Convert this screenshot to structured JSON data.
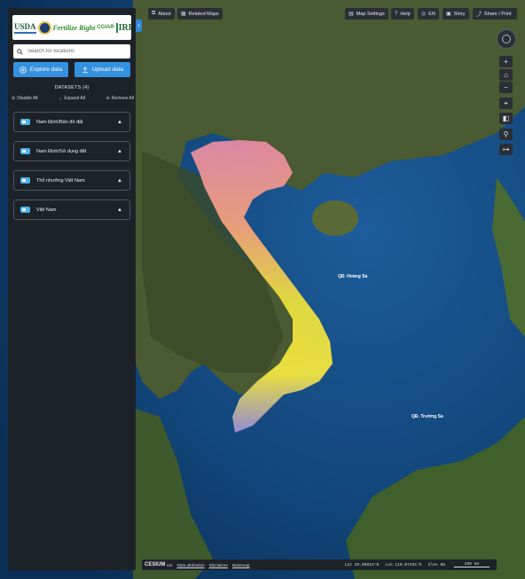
{
  "logos": {
    "usda": "USDA",
    "fertilize_right": "Fertilize Right",
    "cgiar": "CGIAR",
    "irri": "IRRI"
  },
  "search": {
    "placeholder": "Search for locations"
  },
  "buttons": {
    "explore": "Explore data",
    "upload": "Upload data"
  },
  "datasets": {
    "title": "DATASETS (4)",
    "actions": {
      "disable_all": "Disable All",
      "expand_all": "Expand All",
      "remove_all": "Remove All"
    },
    "items": [
      {
        "label": "Nam Định/Bản đồ đất"
      },
      {
        "label": "Nam Định/Sử dụng đất"
      },
      {
        "label": "Thổ nhưỡng Việt Nam"
      },
      {
        "label": "Việt Nam"
      }
    ]
  },
  "toolbar": {
    "about": "About",
    "related_maps": "Related Maps",
    "map_settings": "Map Settings",
    "help": "Help",
    "language": "EN",
    "story": "Story",
    "share": "Share / Print"
  },
  "map_labels": {
    "paracel": "QĐ. Hoàng Sa",
    "spratly": "QĐ. Trường Sa"
  },
  "bottom": {
    "cesium": "CESIUM",
    "ion": "ion",
    "attribution": "Data attribution",
    "disclaimer": "Disclaimer",
    "basemap": "Basemap",
    "lat": "Lat 20.00815°N",
    "lon": "Lon 110.07491°E",
    "elev": "Elev 0m",
    "scale": "200 km"
  },
  "colors": {
    "panel": "#1d2228",
    "accent": "#3491e0",
    "ocean": "#0e3c6e"
  },
  "icons": {
    "search": "search-icon",
    "explore": "plus-circle-icon",
    "upload": "upload-icon",
    "compass": "compass-icon"
  }
}
